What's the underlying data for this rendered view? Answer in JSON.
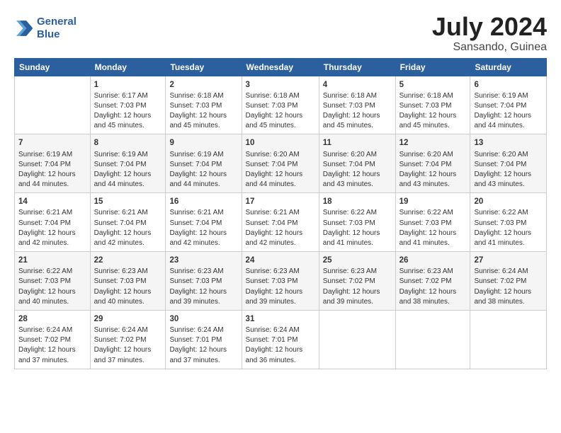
{
  "header": {
    "logo_line1": "General",
    "logo_line2": "Blue",
    "title": "July 2024",
    "location": "Sansando, Guinea"
  },
  "days_of_week": [
    "Sunday",
    "Monday",
    "Tuesday",
    "Wednesday",
    "Thursday",
    "Friday",
    "Saturday"
  ],
  "weeks": [
    [
      {
        "day": "",
        "info": ""
      },
      {
        "day": "1",
        "info": "Sunrise: 6:17 AM\nSunset: 7:03 PM\nDaylight: 12 hours\nand 45 minutes."
      },
      {
        "day": "2",
        "info": "Sunrise: 6:18 AM\nSunset: 7:03 PM\nDaylight: 12 hours\nand 45 minutes."
      },
      {
        "day": "3",
        "info": "Sunrise: 6:18 AM\nSunset: 7:03 PM\nDaylight: 12 hours\nand 45 minutes."
      },
      {
        "day": "4",
        "info": "Sunrise: 6:18 AM\nSunset: 7:03 PM\nDaylight: 12 hours\nand 45 minutes."
      },
      {
        "day": "5",
        "info": "Sunrise: 6:18 AM\nSunset: 7:03 PM\nDaylight: 12 hours\nand 45 minutes."
      },
      {
        "day": "6",
        "info": "Sunrise: 6:19 AM\nSunset: 7:04 PM\nDaylight: 12 hours\nand 44 minutes."
      }
    ],
    [
      {
        "day": "7",
        "info": "Sunrise: 6:19 AM\nSunset: 7:04 PM\nDaylight: 12 hours\nand 44 minutes."
      },
      {
        "day": "8",
        "info": "Sunrise: 6:19 AM\nSunset: 7:04 PM\nDaylight: 12 hours\nand 44 minutes."
      },
      {
        "day": "9",
        "info": "Sunrise: 6:19 AM\nSunset: 7:04 PM\nDaylight: 12 hours\nand 44 minutes."
      },
      {
        "day": "10",
        "info": "Sunrise: 6:20 AM\nSunset: 7:04 PM\nDaylight: 12 hours\nand 44 minutes."
      },
      {
        "day": "11",
        "info": "Sunrise: 6:20 AM\nSunset: 7:04 PM\nDaylight: 12 hours\nand 43 minutes."
      },
      {
        "day": "12",
        "info": "Sunrise: 6:20 AM\nSunset: 7:04 PM\nDaylight: 12 hours\nand 43 minutes."
      },
      {
        "day": "13",
        "info": "Sunrise: 6:20 AM\nSunset: 7:04 PM\nDaylight: 12 hours\nand 43 minutes."
      }
    ],
    [
      {
        "day": "14",
        "info": "Sunrise: 6:21 AM\nSunset: 7:04 PM\nDaylight: 12 hours\nand 42 minutes."
      },
      {
        "day": "15",
        "info": "Sunrise: 6:21 AM\nSunset: 7:04 PM\nDaylight: 12 hours\nand 42 minutes."
      },
      {
        "day": "16",
        "info": "Sunrise: 6:21 AM\nSunset: 7:04 PM\nDaylight: 12 hours\nand 42 minutes."
      },
      {
        "day": "17",
        "info": "Sunrise: 6:21 AM\nSunset: 7:04 PM\nDaylight: 12 hours\nand 42 minutes."
      },
      {
        "day": "18",
        "info": "Sunrise: 6:22 AM\nSunset: 7:03 PM\nDaylight: 12 hours\nand 41 minutes."
      },
      {
        "day": "19",
        "info": "Sunrise: 6:22 AM\nSunset: 7:03 PM\nDaylight: 12 hours\nand 41 minutes."
      },
      {
        "day": "20",
        "info": "Sunrise: 6:22 AM\nSunset: 7:03 PM\nDaylight: 12 hours\nand 41 minutes."
      }
    ],
    [
      {
        "day": "21",
        "info": "Sunrise: 6:22 AM\nSunset: 7:03 PM\nDaylight: 12 hours\nand 40 minutes."
      },
      {
        "day": "22",
        "info": "Sunrise: 6:23 AM\nSunset: 7:03 PM\nDaylight: 12 hours\nand 40 minutes."
      },
      {
        "day": "23",
        "info": "Sunrise: 6:23 AM\nSunset: 7:03 PM\nDaylight: 12 hours\nand 39 minutes."
      },
      {
        "day": "24",
        "info": "Sunrise: 6:23 AM\nSunset: 7:03 PM\nDaylight: 12 hours\nand 39 minutes."
      },
      {
        "day": "25",
        "info": "Sunrise: 6:23 AM\nSunset: 7:02 PM\nDaylight: 12 hours\nand 39 minutes."
      },
      {
        "day": "26",
        "info": "Sunrise: 6:23 AM\nSunset: 7:02 PM\nDaylight: 12 hours\nand 38 minutes."
      },
      {
        "day": "27",
        "info": "Sunrise: 6:24 AM\nSunset: 7:02 PM\nDaylight: 12 hours\nand 38 minutes."
      }
    ],
    [
      {
        "day": "28",
        "info": "Sunrise: 6:24 AM\nSunset: 7:02 PM\nDaylight: 12 hours\nand 37 minutes."
      },
      {
        "day": "29",
        "info": "Sunrise: 6:24 AM\nSunset: 7:02 PM\nDaylight: 12 hours\nand 37 minutes."
      },
      {
        "day": "30",
        "info": "Sunrise: 6:24 AM\nSunset: 7:01 PM\nDaylight: 12 hours\nand 37 minutes."
      },
      {
        "day": "31",
        "info": "Sunrise: 6:24 AM\nSunset: 7:01 PM\nDaylight: 12 hours\nand 36 minutes."
      },
      {
        "day": "",
        "info": ""
      },
      {
        "day": "",
        "info": ""
      },
      {
        "day": "",
        "info": ""
      }
    ]
  ]
}
